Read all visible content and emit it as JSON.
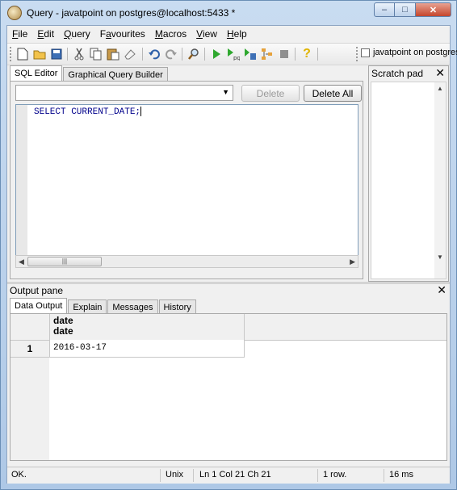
{
  "window": {
    "title": "Query - javatpoint on postgres@localhost:5433 *",
    "controls": {
      "minimize": "‒",
      "maximize": "□",
      "close": "✕"
    }
  },
  "menu": [
    "File",
    "Edit",
    "Query",
    "Favourites",
    "Macros",
    "View",
    "Help"
  ],
  "menu_mnemonics": [
    "F",
    "E",
    "Q",
    "a",
    "M",
    "V",
    "H"
  ],
  "toolbar": {
    "icons": [
      "new-file-icon",
      "open-folder-icon",
      "save-icon",
      "cut-icon",
      "copy-icon",
      "paste-icon",
      "clear-icon",
      "undo-icon",
      "redo-icon",
      "find-icon",
      "execute-icon",
      "execute-pgscript-icon",
      "execute-to-file-icon",
      "explain-icon",
      "cancel-icon",
      "help-icon"
    ],
    "connection_checkbox_label": "javatpoint on postgres"
  },
  "editor": {
    "tabs": [
      "SQL Editor",
      "Graphical Query Builder"
    ],
    "active_tab": "SQL Editor",
    "delete_label": "Delete",
    "delete_all_label": "Delete All",
    "sql": "SELECT CURRENT_DATE;"
  },
  "scratch_pad": {
    "title": "Scratch pad",
    "close": "✕"
  },
  "output": {
    "title": "Output pane",
    "close": "✕",
    "tabs": [
      "Data Output",
      "Explain",
      "Messages",
      "History"
    ],
    "active_tab": "Data Output",
    "columns": [
      {
        "name": "date",
        "type": "date"
      }
    ],
    "rows": [
      {
        "num": "1",
        "values": [
          "2016-03-17"
        ]
      }
    ]
  },
  "status": {
    "message": "OK.",
    "os": "Unix",
    "position": "Ln 1 Col 21 Ch 21",
    "rows": "1 row.",
    "time": "16 ms"
  }
}
